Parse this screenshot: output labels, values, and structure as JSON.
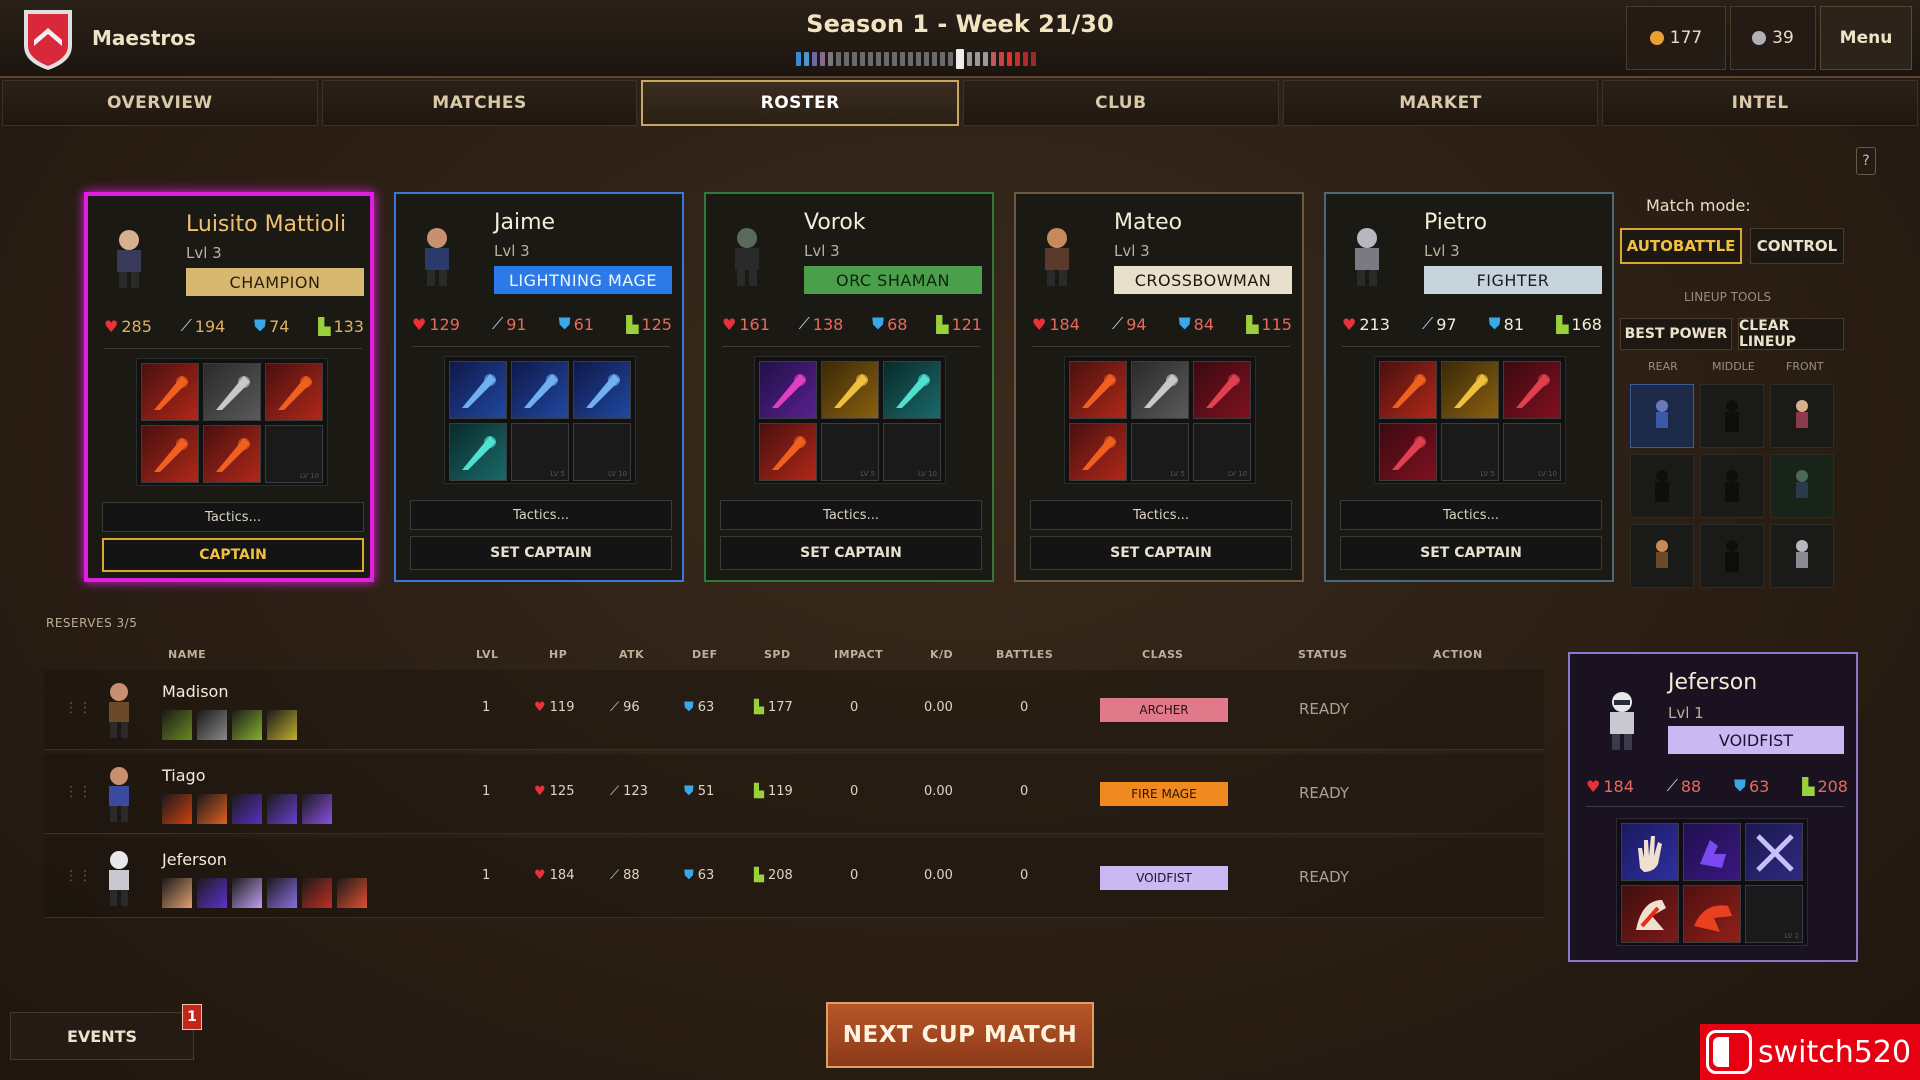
{
  "header": {
    "club_name": "Maestros",
    "season": "Season 1 - Week 21/30",
    "gold": "177",
    "gems": "39",
    "menu": "Menu"
  },
  "tabs": [
    "OVERVIEW",
    "MATCHES",
    "ROSTER",
    "CLUB",
    "MARKET",
    "INTEL"
  ],
  "active_tab": "ROSTER",
  "help": "?",
  "lineup": [
    {
      "name": "Luisito Mattioli",
      "level": "Lvl 3",
      "class": "CHAMPION",
      "hp": "285",
      "atk": "194",
      "def": "74",
      "spd": "133",
      "tactics": "Tactics...",
      "captain": "CAPTAIN",
      "border": "#e020e0",
      "class_bg": "#d8b870",
      "class_fg": "#2a1e0e",
      "name_color": "#f0c070",
      "stat_color": "#e0b060"
    },
    {
      "name": "Jaime",
      "level": "Lvl 3",
      "class": "LIGHTNING MAGE",
      "hp": "129",
      "atk": "91",
      "def": "61",
      "spd": "125",
      "tactics": "Tactics...",
      "captain": "SET CAPTAIN",
      "border": "#3a78d8",
      "class_bg": "#2c7ae8",
      "class_fg": "#f0f4ff",
      "name_color": "#f3ecd8",
      "stat_color": "#e86a5a"
    },
    {
      "name": "Vorok",
      "level": "Lvl 3",
      "class": "ORC SHAMAN",
      "hp": "161",
      "atk": "138",
      "def": "68",
      "spd": "121",
      "tactics": "Tactics...",
      "captain": "SET CAPTAIN",
      "border": "#2e7a3a",
      "class_bg": "#4aa04a",
      "class_fg": "#10200e",
      "name_color": "#f3ecd8",
      "stat_color": "#e86a5a"
    },
    {
      "name": "Mateo",
      "level": "Lvl 3",
      "class": "CROSSBOWMAN",
      "hp": "184",
      "atk": "94",
      "def": "84",
      "spd": "115",
      "tactics": "Tactics...",
      "captain": "SET CAPTAIN",
      "border": "#6a5a40",
      "class_bg": "#e8e0cc",
      "class_fg": "#1a1610",
      "name_color": "#f3ecd8",
      "stat_color": "#e86a5a"
    },
    {
      "name": "Pietro",
      "level": "Lvl 3",
      "class": "FIGHTER",
      "hp": "213",
      "atk": "97",
      "def": "81",
      "spd": "168",
      "tactics": "Tactics...",
      "captain": "SET CAPTAIN",
      "border": "#4a6a7a",
      "class_bg": "#c8d4dc",
      "class_fg": "#1a1e22",
      "name_color": "#f3ecd8",
      "stat_color": "#f3ecd8"
    }
  ],
  "match_mode": {
    "label": "Match mode:",
    "autobattle": "AUTOBATTLE",
    "control": "CONTROL"
  },
  "lineup_tools": {
    "label": "LINEUP TOOLS",
    "best_power": "BEST POWER",
    "clear_lineup": "CLEAR LINEUP",
    "rear": "REAR",
    "middle": "MIDDLE",
    "front": "FRONT"
  },
  "reserves": {
    "label": "RESERVES  3/5",
    "columns": [
      "NAME",
      "LVL",
      "HP",
      "ATK",
      "DEF",
      "SPD",
      "IMPACT",
      "K/D",
      "BATTLES",
      "CLASS",
      "STATUS",
      "ACTION"
    ],
    "rows": [
      {
        "name": "Madison",
        "lvl": "1",
        "hp": "119",
        "atk": "96",
        "def": "63",
        "spd": "177",
        "impact": "0",
        "kd": "0.00",
        "battles": "0",
        "class": "ARCHER",
        "status": "READY",
        "class_bg": "#e07a8a",
        "class_fg": "#2a1014"
      },
      {
        "name": "Tiago",
        "lvl": "1",
        "hp": "125",
        "atk": "123",
        "def": "51",
        "spd": "119",
        "impact": "0",
        "kd": "0.00",
        "battles": "0",
        "class": "FIRE MAGE",
        "status": "READY",
        "class_bg": "#f08a20",
        "class_fg": "#2a1404"
      },
      {
        "name": "Jeferson",
        "lvl": "1",
        "hp": "184",
        "atk": "88",
        "def": "63",
        "spd": "208",
        "impact": "0",
        "kd": "0.00",
        "battles": "0",
        "class": "VOIDFIST",
        "status": "READY",
        "class_bg": "#c9b8f2",
        "class_fg": "#1a1230"
      }
    ]
  },
  "detail": {
    "name": "Jeferson",
    "level": "Lvl 1",
    "class": "VOIDFIST",
    "hp": "184",
    "atk": "88",
    "def": "63",
    "spd": "208"
  },
  "events": {
    "label": "EVENTS",
    "count": "1"
  },
  "next_match": "NEXT CUP MATCH",
  "watermark": "switch520"
}
